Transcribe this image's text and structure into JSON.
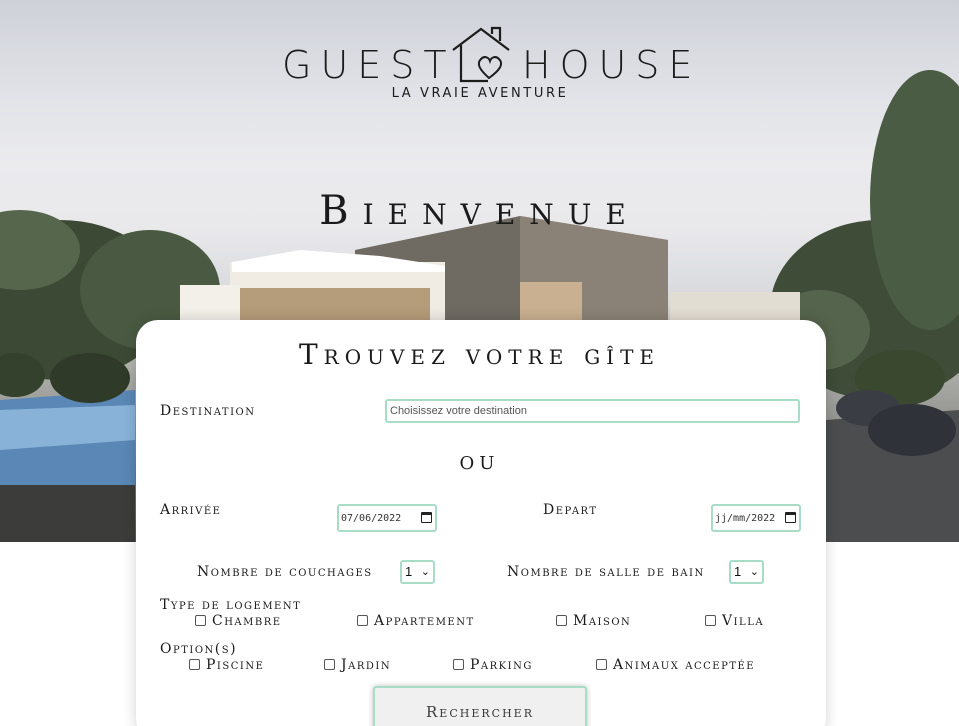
{
  "logo": {
    "word_left": "GUEST",
    "word_right": "HOUSE",
    "tagline": "LA VRAIE AVENTURE"
  },
  "hero": {
    "welcome": "Bienvenue"
  },
  "form": {
    "title": "Trouvez votre gîte",
    "destination": {
      "label": "Destination",
      "placeholder": "Choisissez votre destination"
    },
    "or_label": "ou",
    "arrival": {
      "label": "Arrivée",
      "value": "07/06/2022"
    },
    "departure": {
      "label": "Depart",
      "value": "jj/mm/2022"
    },
    "beds": {
      "label": "Nombre de couchages",
      "value": "1"
    },
    "bathrooms": {
      "label": "Nombre de salle de bain",
      "value": "1"
    },
    "housing_type": {
      "label": "Type de logement",
      "options": [
        "Chambre",
        "Appartement",
        "Maison",
        "Villa"
      ]
    },
    "extras": {
      "label": "Option(s)",
      "options": [
        "Piscine",
        "Jardin",
        "Parking",
        "Animaux acceptée"
      ]
    },
    "submit_label": "Rechercher"
  },
  "colors": {
    "accent": "#a8dcc6"
  },
  "icons": {
    "logo": "house-heart-icon",
    "calendar": "calendar-icon",
    "select": "chevron-down-icon"
  }
}
